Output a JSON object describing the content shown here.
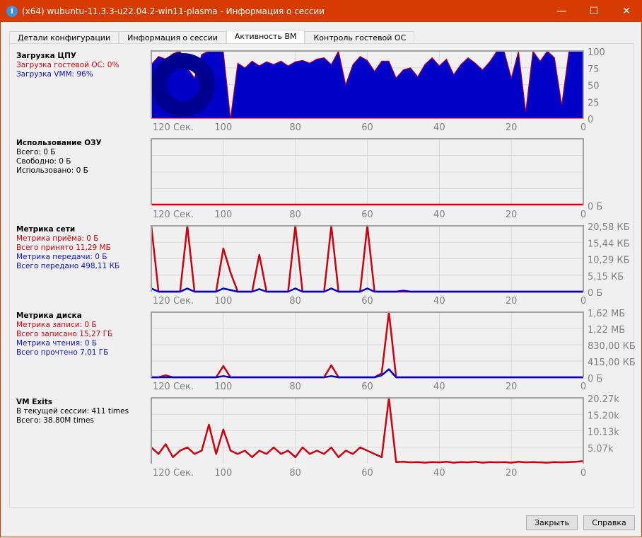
{
  "window": {
    "title": "(x64) wubuntu-11.3.3-u22.04.2-win11-plasma - Информация о сессии",
    "icon": "info-icon",
    "controls": [
      "minimize-icon",
      "maximize-icon",
      "close-icon"
    ]
  },
  "tabs": [
    {
      "label": "Детали конфигурации"
    },
    {
      "label": "Информация о сессии"
    },
    {
      "label": "Активность ВМ",
      "active": true
    },
    {
      "label": "Контроль гостевой ОС"
    }
  ],
  "colors": {
    "accent": "#d83b01",
    "red": "#d00010",
    "blue": "#0000c8",
    "grid": "#d8d8d8",
    "axis": "#a0a0a0"
  },
  "x_labels": [
    "120 Сек.",
    "100",
    "80",
    "60",
    "40",
    "20",
    "0"
  ],
  "cpu": {
    "title": "Загрузка ЦПУ",
    "guest": "Загрузка гостевой ОС: 0%",
    "vmm": "Загрузка VMM: 96%",
    "y_labels": [
      "100",
      "75",
      "50",
      "25",
      "0"
    ],
    "ymax": 100,
    "vmm_series": [
      80,
      92,
      88,
      96,
      100,
      75,
      60,
      95,
      100,
      100,
      100,
      0,
      82,
      75,
      85,
      78,
      84,
      80,
      85,
      78,
      84,
      86,
      82,
      88,
      90,
      80,
      100,
      50,
      80,
      92,
      86,
      70,
      85,
      85,
      60,
      72,
      75,
      62,
      80,
      90,
      78,
      88,
      65,
      80,
      90,
      82,
      72,
      84,
      100,
      100,
      60,
      100,
      10,
      100,
      85,
      100,
      90,
      20,
      100,
      100,
      100
    ],
    "guest_series": [
      0,
      0,
      0,
      0,
      0,
      0,
      0,
      0,
      0,
      0,
      0,
      0,
      0,
      0,
      0,
      0,
      0,
      0,
      0,
      0,
      0,
      0,
      0,
      0,
      0,
      0,
      0,
      0,
      0,
      0,
      0,
      0,
      0,
      0,
      0,
      0,
      0,
      0,
      0,
      0,
      0,
      0,
      0,
      0,
      0,
      0,
      0,
      0,
      0,
      0,
      0,
      0,
      0,
      0,
      0,
      0,
      0,
      0,
      0,
      0,
      0
    ]
  },
  "ram": {
    "title": "Использование ОЗУ",
    "total": "Всего: 0 Б",
    "free": "Свободно: 0 Б",
    "used": "Использовано: 0 Б",
    "y_labels": [
      "0 Б"
    ]
  },
  "net": {
    "title": "Метрика сети",
    "rx_rate": "Метрика приёма: 0 Б",
    "rx_total": "Всего принято 11,29 МБ",
    "tx_rate": "Метрика передачи: 0 Б",
    "tx_total": "Всего передано 498,11 КБ",
    "y_labels": [
      "20,58 КБ",
      "15,44 КБ",
      "10,29 КБ",
      "5,15 КБ",
      "0 Б"
    ],
    "ymax": 20.58,
    "rx_series": [
      20.58,
      0,
      0,
      0,
      0,
      20.58,
      0,
      0,
      0,
      0,
      13.5,
      6,
      0,
      0,
      0,
      11.5,
      0,
      0,
      0,
      0,
      20.58,
      0,
      0,
      0,
      0,
      20.58,
      0,
      0,
      0,
      0,
      20.58,
      0,
      0,
      0,
      0,
      0,
      0,
      0,
      0,
      0,
      0,
      0,
      0,
      0,
      0,
      0,
      0,
      0,
      0,
      0,
      0,
      0,
      0,
      0,
      0,
      0,
      0,
      0,
      0,
      0,
      0
    ],
    "tx_series": [
      1,
      0,
      0,
      0,
      0,
      1,
      0,
      0,
      0,
      0,
      1,
      0.5,
      0,
      0,
      0,
      0.8,
      0,
      0,
      0,
      0,
      1,
      0,
      0,
      0,
      0,
      1,
      0,
      0,
      0,
      0,
      1,
      0,
      0,
      0,
      0,
      0.3,
      0,
      0,
      0,
      0,
      0,
      0,
      0,
      0,
      0,
      0,
      0,
      0,
      0,
      0,
      0,
      0,
      0,
      0,
      0,
      0,
      0,
      0,
      0,
      0,
      0
    ]
  },
  "disk": {
    "title": "Метрика диска",
    "w_rate": "Метрика записи: 0 Б",
    "w_total": "Всего записано 15,27 ГБ",
    "r_rate": "Метрика чтения: 0 Б",
    "r_total": "Всего прочтено 7,01 ГБ",
    "y_labels": [
      "1,62 МБ",
      "1,22 МБ",
      "830,00 КБ",
      "415,00 КБ",
      "0 Б"
    ],
    "ymax": 1.62,
    "w_series": [
      0,
      0,
      0.05,
      0,
      0,
      0,
      0,
      0,
      0,
      0,
      0.28,
      0,
      0,
      0,
      0,
      0,
      0,
      0,
      0,
      0,
      0,
      0,
      0,
      0,
      0,
      0.3,
      0,
      0,
      0,
      0,
      0,
      0,
      0.1,
      1.62,
      0,
      0,
      0,
      0,
      0,
      0,
      0,
      0,
      0,
      0,
      0,
      0,
      0,
      0,
      0,
      0,
      0,
      0,
      0,
      0,
      0,
      0,
      0,
      0,
      0,
      0,
      0
    ],
    "r_series": [
      0,
      0,
      0,
      0,
      0,
      0,
      0,
      0,
      0,
      0,
      0.03,
      0,
      0,
      0,
      0,
      0,
      0,
      0,
      0,
      0,
      0,
      0,
      0,
      0,
      0,
      0.03,
      0,
      0,
      0,
      0,
      0,
      0,
      0.05,
      0.2,
      0,
      0,
      0,
      0,
      0,
      0,
      0,
      0,
      0,
      0,
      0,
      0,
      0,
      0,
      0,
      0,
      0,
      0,
      0,
      0,
      0,
      0,
      0,
      0,
      0,
      0,
      0
    ]
  },
  "exits": {
    "title": "VM Exits",
    "session": "В текущей сессии: 411 times",
    "total": "Всего: 38.80M times",
    "y_labels": [
      "20.27k",
      "15.20k",
      "10.13k",
      "5.07k"
    ],
    "ymax": 20.27,
    "series": [
      5,
      3,
      6,
      2,
      4,
      5,
      3,
      4,
      12,
      3,
      10.5,
      4,
      3,
      4,
      2,
      4,
      3,
      5,
      3,
      4,
      2,
      5,
      3,
      4,
      3,
      5,
      2,
      4,
      3,
      5,
      4,
      3,
      2,
      20.27,
      0.5,
      0.6,
      0.4,
      0.5,
      0.3,
      0.5,
      0.4,
      0.6,
      0.3,
      0.5,
      0.4,
      0.6,
      0.3,
      0.5,
      0.4,
      0.5,
      0.3,
      0.6,
      0.4,
      0.5,
      0.4,
      0.3,
      0.5,
      0.4,
      0.5,
      0.6,
      0.8
    ]
  },
  "buttons": {
    "close": "Закрыть",
    "help": "Справка"
  }
}
